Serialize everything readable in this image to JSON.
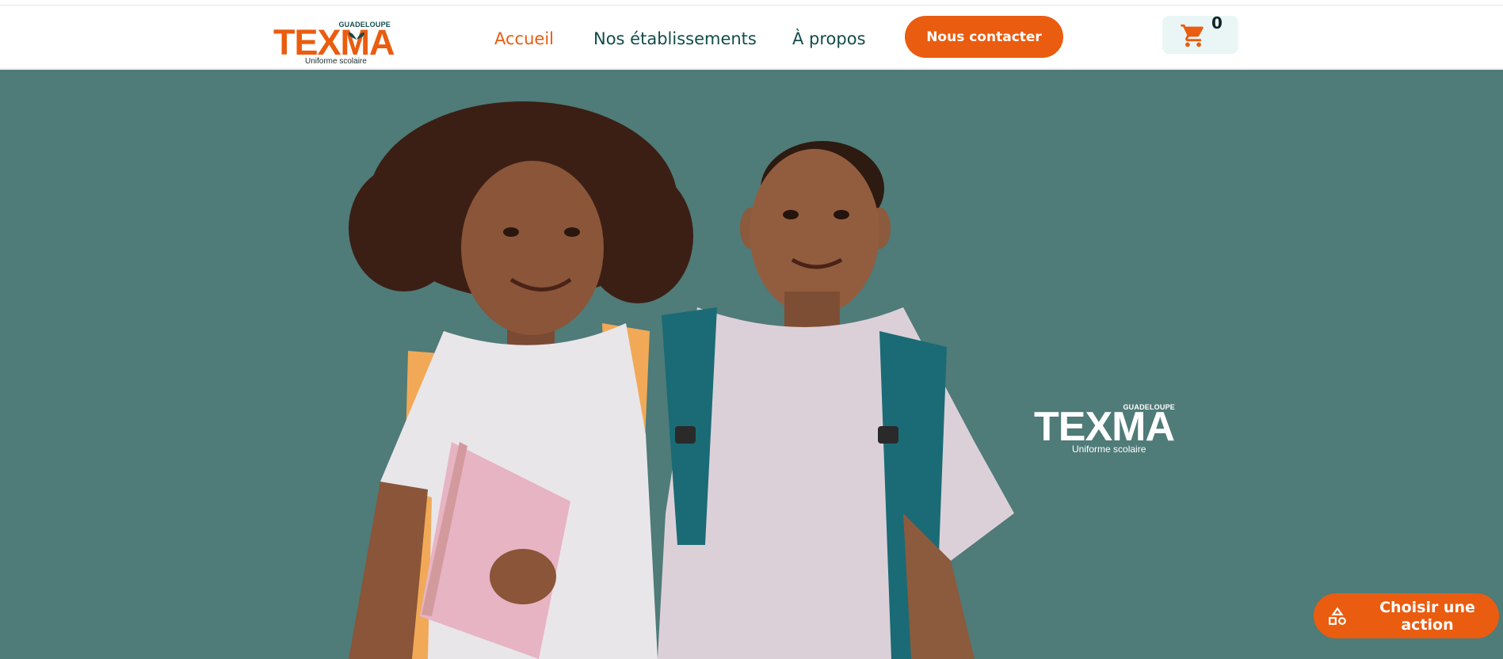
{
  "brand": {
    "name": "TEXMA",
    "region": "GUADELOUPE",
    "tagline": "Uniforme scolaire",
    "logo_icon": "butterfly-leaf-icon"
  },
  "nav": {
    "items": [
      {
        "label": "Accueil",
        "active": true
      },
      {
        "label": "Nos établissements",
        "active": false
      },
      {
        "label": "À propos",
        "active": false
      }
    ],
    "contact_label": "Nous contacter"
  },
  "cart": {
    "icon": "cart-icon",
    "count": "0"
  },
  "hero": {
    "image": "two-schoolchildren-with-backpacks-photo",
    "logo_name": "TEXMA",
    "logo_region": "GUADELOUPE",
    "logo_tagline": "Uniforme scolaire"
  },
  "floating_action": {
    "icon": "shapes-icon",
    "label": "Choisir une action"
  },
  "colors": {
    "accent": "#ea5c10",
    "brand_dark": "#124c4a",
    "hero_bg": "#4f7b78",
    "cart_bg": "#eaf6f6"
  }
}
